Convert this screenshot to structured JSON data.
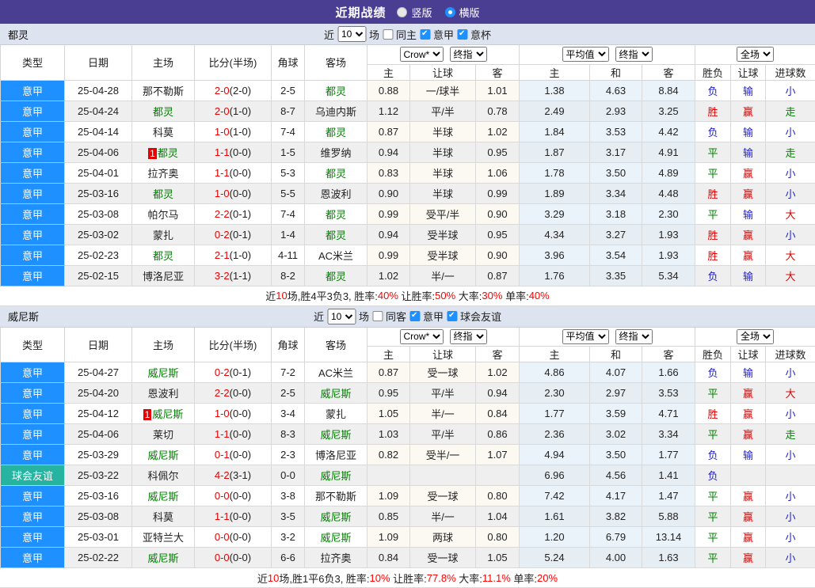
{
  "palette": {
    "topbar_bg": "#4a3e92",
    "league_blue": "#1e90ff",
    "friendly_teal": "#26b3a0",
    "focus_team_green": "#008000",
    "score_red": "#e60000",
    "result_red": "#e10000",
    "result_green": "#008000",
    "result_blue": "#2121cc",
    "section_bg": "#dde3ef"
  },
  "topbar": {
    "title": "近期战绩",
    "radios": [
      {
        "label": "竖版",
        "checked": false
      },
      {
        "label": "横版",
        "checked": true
      }
    ]
  },
  "result_colors": {
    "胜": "#e10000",
    "负": "#2121cc",
    "平": "#008000",
    "赢": "#e10000",
    "输": "#2121cc",
    "走": "#008000",
    "大": "#e10000",
    "小": "#2121cc"
  },
  "tables": [
    {
      "team": "都灵",
      "filter": {
        "near": "近",
        "select": "10",
        "games": "场",
        "checkboxes": [
          {
            "label": "同主",
            "checked": false
          },
          {
            "label": "意甲",
            "checked": true
          },
          {
            "label": "意杯",
            "checked": true
          }
        ]
      },
      "headers": {
        "cols": [
          "类型",
          "日期",
          "主场",
          "比分(半场)",
          "角球",
          "客场"
        ],
        "crow_select": "Crow*",
        "crow_ref": "终指",
        "avg_select": "平均值",
        "avg_ref": "终指",
        "full_select": "全场",
        "sub": [
          "主",
          "让球",
          "客",
          "主",
          "和",
          "客",
          "胜负",
          "让球",
          "进球数"
        ]
      },
      "rows": [
        {
          "type": "意甲",
          "type_style": "league",
          "date": "25-04-28",
          "home": {
            "name": "那不勒斯",
            "focus": false,
            "badge": ""
          },
          "score": "2-0",
          "half": "(2-0)",
          "corner": "2-5",
          "away": {
            "name": "都灵",
            "focus": true,
            "badge": ""
          },
          "crow": [
            "0.88",
            "一/球半",
            "1.01"
          ],
          "avg": [
            "1.38",
            "4.63",
            "8.84"
          ],
          "full": [
            "负",
            "输",
            "小"
          ]
        },
        {
          "type": "意甲",
          "type_style": "league",
          "date": "25-04-24",
          "home": {
            "name": "都灵",
            "focus": true,
            "badge": ""
          },
          "score": "2-0",
          "half": "(1-0)",
          "corner": "8-7",
          "away": {
            "name": "乌迪内斯",
            "focus": false,
            "badge": ""
          },
          "crow": [
            "1.12",
            "平/半",
            "0.78"
          ],
          "avg": [
            "2.49",
            "2.93",
            "3.25"
          ],
          "full": [
            "胜",
            "赢",
            "走"
          ]
        },
        {
          "type": "意甲",
          "type_style": "league",
          "date": "25-04-14",
          "home": {
            "name": "科莫",
            "focus": false,
            "badge": ""
          },
          "score": "1-0",
          "half": "(1-0)",
          "corner": "7-4",
          "away": {
            "name": "都灵",
            "focus": true,
            "badge": ""
          },
          "crow": [
            "0.87",
            "半球",
            "1.02"
          ],
          "avg": [
            "1.84",
            "3.53",
            "4.42"
          ],
          "full": [
            "负",
            "输",
            "小"
          ]
        },
        {
          "type": "意甲",
          "type_style": "league",
          "date": "25-04-06",
          "home": {
            "name": "都灵",
            "focus": true,
            "badge": "1"
          },
          "score": "1-1",
          "half": "(0-0)",
          "corner": "1-5",
          "away": {
            "name": "维罗纳",
            "focus": false,
            "badge": ""
          },
          "crow": [
            "0.94",
            "半球",
            "0.95"
          ],
          "avg": [
            "1.87",
            "3.17",
            "4.91"
          ],
          "full": [
            "平",
            "输",
            "走"
          ]
        },
        {
          "type": "意甲",
          "type_style": "league",
          "date": "25-04-01",
          "home": {
            "name": "拉齐奥",
            "focus": false,
            "badge": ""
          },
          "score": "1-1",
          "half": "(0-0)",
          "corner": "5-3",
          "away": {
            "name": "都灵",
            "focus": true,
            "badge": ""
          },
          "crow": [
            "0.83",
            "半球",
            "1.06"
          ],
          "avg": [
            "1.78",
            "3.50",
            "4.89"
          ],
          "full": [
            "平",
            "赢",
            "小"
          ]
        },
        {
          "type": "意甲",
          "type_style": "league",
          "date": "25-03-16",
          "home": {
            "name": "都灵",
            "focus": true,
            "badge": ""
          },
          "score": "1-0",
          "half": "(0-0)",
          "corner": "5-5",
          "away": {
            "name": "恩波利",
            "focus": false,
            "badge": ""
          },
          "crow": [
            "0.90",
            "半球",
            "0.99"
          ],
          "avg": [
            "1.89",
            "3.34",
            "4.48"
          ],
          "full": [
            "胜",
            "赢",
            "小"
          ]
        },
        {
          "type": "意甲",
          "type_style": "league",
          "date": "25-03-08",
          "home": {
            "name": "帕尔马",
            "focus": false,
            "badge": ""
          },
          "score": "2-2",
          "half": "(0-1)",
          "corner": "7-4",
          "away": {
            "name": "都灵",
            "focus": true,
            "badge": ""
          },
          "crow": [
            "0.99",
            "受平/半",
            "0.90"
          ],
          "avg": [
            "3.29",
            "3.18",
            "2.30"
          ],
          "full": [
            "平",
            "输",
            "大"
          ]
        },
        {
          "type": "意甲",
          "type_style": "league",
          "date": "25-03-02",
          "home": {
            "name": "蒙扎",
            "focus": false,
            "badge": ""
          },
          "score": "0-2",
          "half": "(0-1)",
          "corner": "1-4",
          "away": {
            "name": "都灵",
            "focus": true,
            "badge": ""
          },
          "crow": [
            "0.94",
            "受半球",
            "0.95"
          ],
          "avg": [
            "4.34",
            "3.27",
            "1.93"
          ],
          "full": [
            "胜",
            "赢",
            "小"
          ]
        },
        {
          "type": "意甲",
          "type_style": "league",
          "date": "25-02-23",
          "home": {
            "name": "都灵",
            "focus": true,
            "badge": ""
          },
          "score": "2-1",
          "half": "(1-0)",
          "corner": "4-11",
          "away": {
            "name": "AC米兰",
            "focus": false,
            "badge": ""
          },
          "crow": [
            "0.99",
            "受半球",
            "0.90"
          ],
          "avg": [
            "3.96",
            "3.54",
            "1.93"
          ],
          "full": [
            "胜",
            "赢",
            "大"
          ]
        },
        {
          "type": "意甲",
          "type_style": "league",
          "date": "25-02-15",
          "home": {
            "name": "博洛尼亚",
            "focus": false,
            "badge": ""
          },
          "score": "3-2",
          "half": "(1-1)",
          "corner": "8-2",
          "away": {
            "name": "都灵",
            "focus": true,
            "badge": ""
          },
          "crow": [
            "1.02",
            "半/一",
            "0.87"
          ],
          "avg": [
            "1.76",
            "3.35",
            "5.34"
          ],
          "full": [
            "负",
            "输",
            "大"
          ]
        }
      ],
      "summary": [
        [
          "近",
          "k"
        ],
        [
          "10",
          "r"
        ],
        [
          "场,胜4平3负3, 胜率:",
          "k"
        ],
        [
          "40%",
          "r"
        ],
        [
          " 让胜率:",
          "k"
        ],
        [
          "50%",
          "r"
        ],
        [
          " 大率:",
          "k"
        ],
        [
          "30%",
          "r"
        ],
        [
          " 单率:",
          "k"
        ],
        [
          "40%",
          "r"
        ]
      ]
    },
    {
      "team": "威尼斯",
      "filter": {
        "near": "近",
        "select": "10",
        "games": "场",
        "checkboxes": [
          {
            "label": "同客",
            "checked": false
          },
          {
            "label": "意甲",
            "checked": true
          },
          {
            "label": "球会友谊",
            "checked": true
          }
        ]
      },
      "headers": {
        "cols": [
          "类型",
          "日期",
          "主场",
          "比分(半场)",
          "角球",
          "客场"
        ],
        "crow_select": "Crow*",
        "crow_ref": "终指",
        "avg_select": "平均值",
        "avg_ref": "终指",
        "full_select": "全场",
        "sub": [
          "主",
          "让球",
          "客",
          "主",
          "和",
          "客",
          "胜负",
          "让球",
          "进球数"
        ]
      },
      "rows": [
        {
          "type": "意甲",
          "type_style": "league",
          "date": "25-04-27",
          "home": {
            "name": "威尼斯",
            "focus": true,
            "badge": ""
          },
          "score": "0-2",
          "half": "(0-1)",
          "corner": "7-2",
          "away": {
            "name": "AC米兰",
            "focus": false,
            "badge": ""
          },
          "crow": [
            "0.87",
            "受一球",
            "1.02"
          ],
          "avg": [
            "4.86",
            "4.07",
            "1.66"
          ],
          "full": [
            "负",
            "输",
            "小"
          ]
        },
        {
          "type": "意甲",
          "type_style": "league",
          "date": "25-04-20",
          "home": {
            "name": "恩波利",
            "focus": false,
            "badge": ""
          },
          "score": "2-2",
          "half": "(0-0)",
          "corner": "2-5",
          "away": {
            "name": "威尼斯",
            "focus": true,
            "badge": ""
          },
          "crow": [
            "0.95",
            "平/半",
            "0.94"
          ],
          "avg": [
            "2.30",
            "2.97",
            "3.53"
          ],
          "full": [
            "平",
            "赢",
            "大"
          ]
        },
        {
          "type": "意甲",
          "type_style": "league",
          "date": "25-04-12",
          "home": {
            "name": "威尼斯",
            "focus": true,
            "badge": "1"
          },
          "score": "1-0",
          "half": "(0-0)",
          "corner": "3-4",
          "away": {
            "name": "蒙扎",
            "focus": false,
            "badge": ""
          },
          "crow": [
            "1.05",
            "半/一",
            "0.84"
          ],
          "avg": [
            "1.77",
            "3.59",
            "4.71"
          ],
          "full": [
            "胜",
            "赢",
            "小"
          ]
        },
        {
          "type": "意甲",
          "type_style": "league",
          "date": "25-04-06",
          "home": {
            "name": "莱切",
            "focus": false,
            "badge": ""
          },
          "score": "1-1",
          "half": "(0-0)",
          "corner": "8-3",
          "away": {
            "name": "威尼斯",
            "focus": true,
            "badge": ""
          },
          "crow": [
            "1.03",
            "平/半",
            "0.86"
          ],
          "avg": [
            "2.36",
            "3.02",
            "3.34"
          ],
          "full": [
            "平",
            "赢",
            "走"
          ]
        },
        {
          "type": "意甲",
          "type_style": "league",
          "date": "25-03-29",
          "home": {
            "name": "威尼斯",
            "focus": true,
            "badge": ""
          },
          "score": "0-1",
          "half": "(0-0)",
          "corner": "2-3",
          "away": {
            "name": "博洛尼亚",
            "focus": false,
            "badge": ""
          },
          "crow": [
            "0.82",
            "受半/一",
            "1.07"
          ],
          "avg": [
            "4.94",
            "3.50",
            "1.77"
          ],
          "full": [
            "负",
            "输",
            "小"
          ]
        },
        {
          "type": "球会友谊",
          "type_style": "friendly",
          "date": "25-03-22",
          "home": {
            "name": "科佩尔",
            "focus": false,
            "badge": ""
          },
          "score": "4-2",
          "half": "(3-1)",
          "corner": "0-0",
          "away": {
            "name": "威尼斯",
            "focus": true,
            "badge": ""
          },
          "crow": [
            "",
            "",
            ""
          ],
          "avg": [
            "6.96",
            "4.56",
            "1.41"
          ],
          "full": [
            "负",
            "",
            ""
          ]
        },
        {
          "type": "意甲",
          "type_style": "league",
          "date": "25-03-16",
          "home": {
            "name": "威尼斯",
            "focus": true,
            "badge": ""
          },
          "score": "0-0",
          "half": "(0-0)",
          "corner": "3-8",
          "away": {
            "name": "那不勒斯",
            "focus": false,
            "badge": ""
          },
          "crow": [
            "1.09",
            "受一球",
            "0.80"
          ],
          "avg": [
            "7.42",
            "4.17",
            "1.47"
          ],
          "full": [
            "平",
            "赢",
            "小"
          ]
        },
        {
          "type": "意甲",
          "type_style": "league",
          "date": "25-03-08",
          "home": {
            "name": "科莫",
            "focus": false,
            "badge": ""
          },
          "score": "1-1",
          "half": "(0-0)",
          "corner": "3-5",
          "away": {
            "name": "威尼斯",
            "focus": true,
            "badge": ""
          },
          "crow": [
            "0.85",
            "半/一",
            "1.04"
          ],
          "avg": [
            "1.61",
            "3.82",
            "5.88"
          ],
          "full": [
            "平",
            "赢",
            "小"
          ]
        },
        {
          "type": "意甲",
          "type_style": "league",
          "date": "25-03-01",
          "home": {
            "name": "亚特兰大",
            "focus": false,
            "badge": ""
          },
          "score": "0-0",
          "half": "(0-0)",
          "corner": "3-2",
          "away": {
            "name": "威尼斯",
            "focus": true,
            "badge": ""
          },
          "crow": [
            "1.09",
            "两球",
            "0.80"
          ],
          "avg": [
            "1.20",
            "6.79",
            "13.14"
          ],
          "full": [
            "平",
            "赢",
            "小"
          ]
        },
        {
          "type": "意甲",
          "type_style": "league",
          "date": "25-02-22",
          "home": {
            "name": "威尼斯",
            "focus": true,
            "badge": ""
          },
          "score": "0-0",
          "half": "(0-0)",
          "corner": "6-6",
          "away": {
            "name": "拉齐奥",
            "focus": false,
            "badge": ""
          },
          "crow": [
            "0.84",
            "受一球",
            "1.05"
          ],
          "avg": [
            "5.24",
            "4.00",
            "1.63"
          ],
          "full": [
            "平",
            "赢",
            "小"
          ]
        }
      ],
      "summary": [
        [
          "近",
          "k"
        ],
        [
          "10",
          "r"
        ],
        [
          "场,胜1平6负3, 胜率:",
          "k"
        ],
        [
          "10%",
          "r"
        ],
        [
          " 让胜率:",
          "k"
        ],
        [
          "77.8%",
          "r"
        ],
        [
          " 大率:",
          "k"
        ],
        [
          "11.1%",
          "r"
        ],
        [
          " 单率:",
          "k"
        ],
        [
          "20%",
          "r"
        ]
      ]
    }
  ]
}
